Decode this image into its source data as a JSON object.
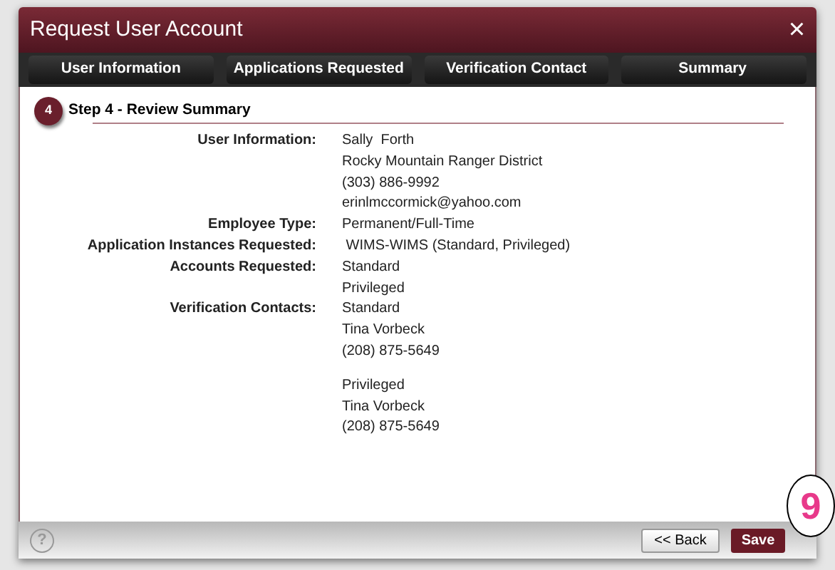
{
  "window": {
    "title": "Request User Account",
    "close": "×"
  },
  "tabs": [
    "User Information",
    "Applications Requested",
    "Verification Contact",
    "Summary"
  ],
  "step": {
    "number": "4",
    "title": "Step 4 - Review Summary"
  },
  "rows": [
    {
      "label": "User Information:",
      "blocks": [
        [
          "Sally  Forth",
          "Rocky Mountain Ranger District",
          "(303) 886-9992",
          "erinlmccormick@yahoo.com"
        ]
      ]
    },
    {
      "label": "Employee Type:",
      "blocks": [
        [
          "Permanent/Full-Time"
        ]
      ]
    },
    {
      "label": "Application Instances Requested:",
      "blocks": [
        [
          " WIMS-WIMS (Standard, Privileged)"
        ]
      ]
    },
    {
      "label": "Accounts Requested:",
      "blocks": [
        [
          "Standard",
          "Privileged"
        ]
      ]
    },
    {
      "label": "Verification Contacts:",
      "blocks": [
        [
          "Standard",
          "Tina Vorbeck",
          "(208) 875-5649"
        ],
        [
          "Privileged",
          "Tina Vorbeck",
          "(208) 875-5649"
        ]
      ]
    }
  ],
  "footer": {
    "help": "?",
    "back": "<< Back",
    "save": "Save"
  },
  "callout": "9"
}
